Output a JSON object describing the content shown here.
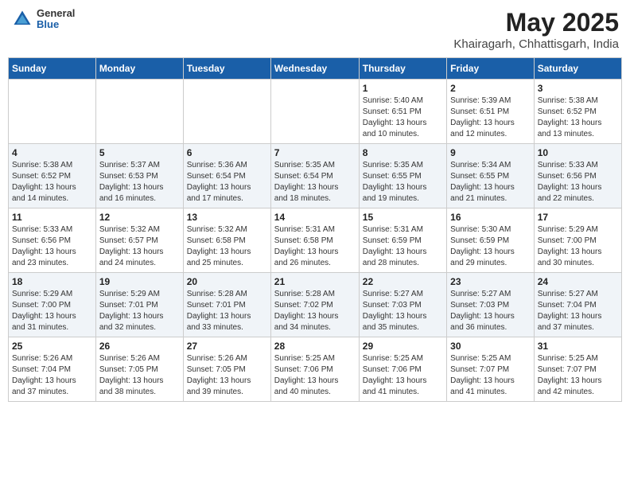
{
  "header": {
    "logo_general": "General",
    "logo_blue": "Blue",
    "title": "May 2025",
    "location": "Khairagarh, Chhattisgarh, India"
  },
  "weekdays": [
    "Sunday",
    "Monday",
    "Tuesday",
    "Wednesday",
    "Thursday",
    "Friday",
    "Saturday"
  ],
  "weeks": [
    [
      {
        "day": "",
        "info": ""
      },
      {
        "day": "",
        "info": ""
      },
      {
        "day": "",
        "info": ""
      },
      {
        "day": "",
        "info": ""
      },
      {
        "day": "1",
        "info": "Sunrise: 5:40 AM\nSunset: 6:51 PM\nDaylight: 13 hours\nand 10 minutes."
      },
      {
        "day": "2",
        "info": "Sunrise: 5:39 AM\nSunset: 6:51 PM\nDaylight: 13 hours\nand 12 minutes."
      },
      {
        "day": "3",
        "info": "Sunrise: 5:38 AM\nSunset: 6:52 PM\nDaylight: 13 hours\nand 13 minutes."
      }
    ],
    [
      {
        "day": "4",
        "info": "Sunrise: 5:38 AM\nSunset: 6:52 PM\nDaylight: 13 hours\nand 14 minutes."
      },
      {
        "day": "5",
        "info": "Sunrise: 5:37 AM\nSunset: 6:53 PM\nDaylight: 13 hours\nand 16 minutes."
      },
      {
        "day": "6",
        "info": "Sunrise: 5:36 AM\nSunset: 6:54 PM\nDaylight: 13 hours\nand 17 minutes."
      },
      {
        "day": "7",
        "info": "Sunrise: 5:35 AM\nSunset: 6:54 PM\nDaylight: 13 hours\nand 18 minutes."
      },
      {
        "day": "8",
        "info": "Sunrise: 5:35 AM\nSunset: 6:55 PM\nDaylight: 13 hours\nand 19 minutes."
      },
      {
        "day": "9",
        "info": "Sunrise: 5:34 AM\nSunset: 6:55 PM\nDaylight: 13 hours\nand 21 minutes."
      },
      {
        "day": "10",
        "info": "Sunrise: 5:33 AM\nSunset: 6:56 PM\nDaylight: 13 hours\nand 22 minutes."
      }
    ],
    [
      {
        "day": "11",
        "info": "Sunrise: 5:33 AM\nSunset: 6:56 PM\nDaylight: 13 hours\nand 23 minutes."
      },
      {
        "day": "12",
        "info": "Sunrise: 5:32 AM\nSunset: 6:57 PM\nDaylight: 13 hours\nand 24 minutes."
      },
      {
        "day": "13",
        "info": "Sunrise: 5:32 AM\nSunset: 6:58 PM\nDaylight: 13 hours\nand 25 minutes."
      },
      {
        "day": "14",
        "info": "Sunrise: 5:31 AM\nSunset: 6:58 PM\nDaylight: 13 hours\nand 26 minutes."
      },
      {
        "day": "15",
        "info": "Sunrise: 5:31 AM\nSunset: 6:59 PM\nDaylight: 13 hours\nand 28 minutes."
      },
      {
        "day": "16",
        "info": "Sunrise: 5:30 AM\nSunset: 6:59 PM\nDaylight: 13 hours\nand 29 minutes."
      },
      {
        "day": "17",
        "info": "Sunrise: 5:29 AM\nSunset: 7:00 PM\nDaylight: 13 hours\nand 30 minutes."
      }
    ],
    [
      {
        "day": "18",
        "info": "Sunrise: 5:29 AM\nSunset: 7:00 PM\nDaylight: 13 hours\nand 31 minutes."
      },
      {
        "day": "19",
        "info": "Sunrise: 5:29 AM\nSunset: 7:01 PM\nDaylight: 13 hours\nand 32 minutes."
      },
      {
        "day": "20",
        "info": "Sunrise: 5:28 AM\nSunset: 7:01 PM\nDaylight: 13 hours\nand 33 minutes."
      },
      {
        "day": "21",
        "info": "Sunrise: 5:28 AM\nSunset: 7:02 PM\nDaylight: 13 hours\nand 34 minutes."
      },
      {
        "day": "22",
        "info": "Sunrise: 5:27 AM\nSunset: 7:03 PM\nDaylight: 13 hours\nand 35 minutes."
      },
      {
        "day": "23",
        "info": "Sunrise: 5:27 AM\nSunset: 7:03 PM\nDaylight: 13 hours\nand 36 minutes."
      },
      {
        "day": "24",
        "info": "Sunrise: 5:27 AM\nSunset: 7:04 PM\nDaylight: 13 hours\nand 37 minutes."
      }
    ],
    [
      {
        "day": "25",
        "info": "Sunrise: 5:26 AM\nSunset: 7:04 PM\nDaylight: 13 hours\nand 37 minutes."
      },
      {
        "day": "26",
        "info": "Sunrise: 5:26 AM\nSunset: 7:05 PM\nDaylight: 13 hours\nand 38 minutes."
      },
      {
        "day": "27",
        "info": "Sunrise: 5:26 AM\nSunset: 7:05 PM\nDaylight: 13 hours\nand 39 minutes."
      },
      {
        "day": "28",
        "info": "Sunrise: 5:25 AM\nSunset: 7:06 PM\nDaylight: 13 hours\nand 40 minutes."
      },
      {
        "day": "29",
        "info": "Sunrise: 5:25 AM\nSunset: 7:06 PM\nDaylight: 13 hours\nand 41 minutes."
      },
      {
        "day": "30",
        "info": "Sunrise: 5:25 AM\nSunset: 7:07 PM\nDaylight: 13 hours\nand 41 minutes."
      },
      {
        "day": "31",
        "info": "Sunrise: 5:25 AM\nSunset: 7:07 PM\nDaylight: 13 hours\nand 42 minutes."
      }
    ]
  ]
}
